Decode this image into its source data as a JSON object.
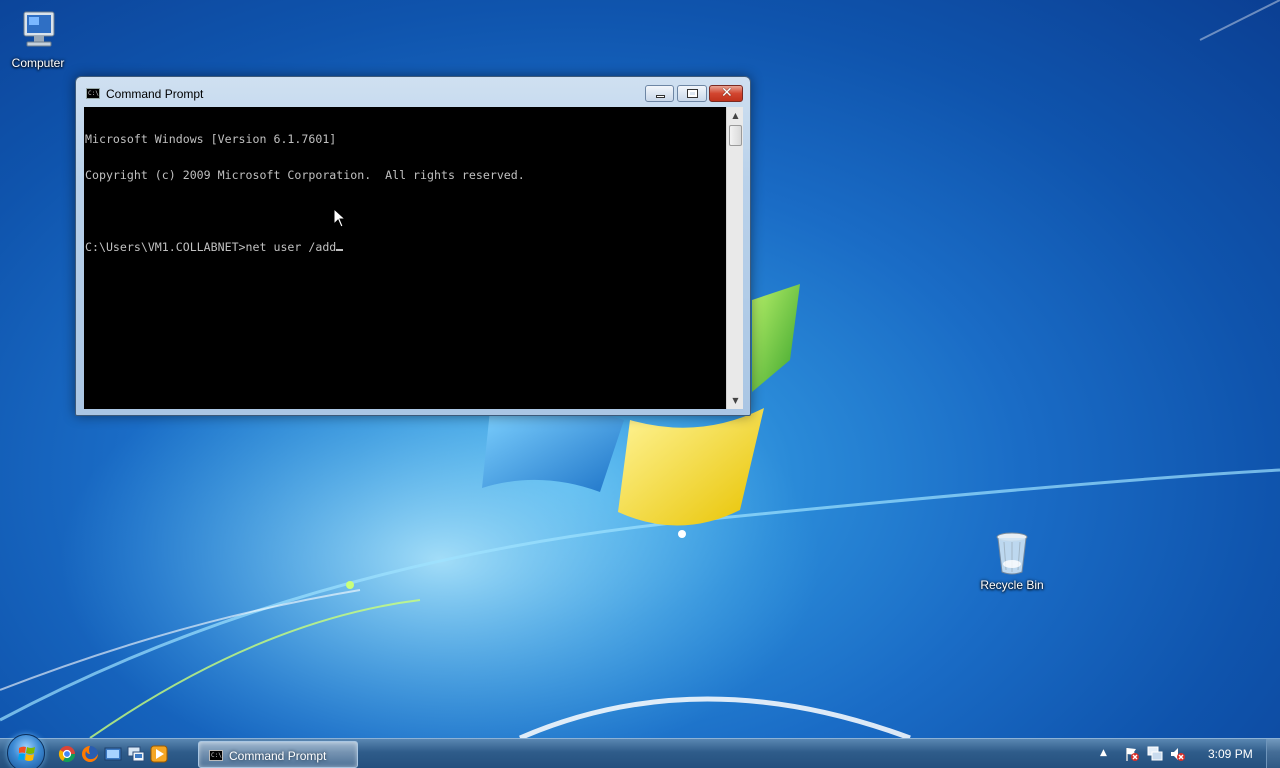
{
  "desktop": {
    "icons": [
      {
        "label": "Computer",
        "icon": "computer-icon"
      },
      {
        "label": "Recycle Bin",
        "icon": "recycle-bin-icon"
      }
    ]
  },
  "window": {
    "title": "Command Prompt",
    "icon": "console-icon",
    "buttons": {
      "minimize": "minimize-icon",
      "maximize": "maximize-icon",
      "close": "close-icon"
    },
    "console": {
      "lines": [
        "Microsoft Windows [Version 6.1.7601]",
        "Copyright (c) 2009 Microsoft Corporation.  All rights reserved.",
        "",
        "C:\\Users\\VM1.COLLABNET>net user /add"
      ],
      "colors": {
        "background": "#000000",
        "text": "#c0c0c0"
      }
    }
  },
  "taskbar": {
    "start_icon": "windows-start-icon",
    "quick_launch": [
      "chrome-icon",
      "firefox-icon",
      "explorer-icon",
      "network-icon",
      "media-player-icon"
    ],
    "active_task": "Command Prompt",
    "tray": {
      "icons": [
        "show-hidden-icons-arrow",
        "action-center-flag-icon",
        "network-icon",
        "volume-muted-icon"
      ],
      "clock": "3:09 PM"
    }
  }
}
